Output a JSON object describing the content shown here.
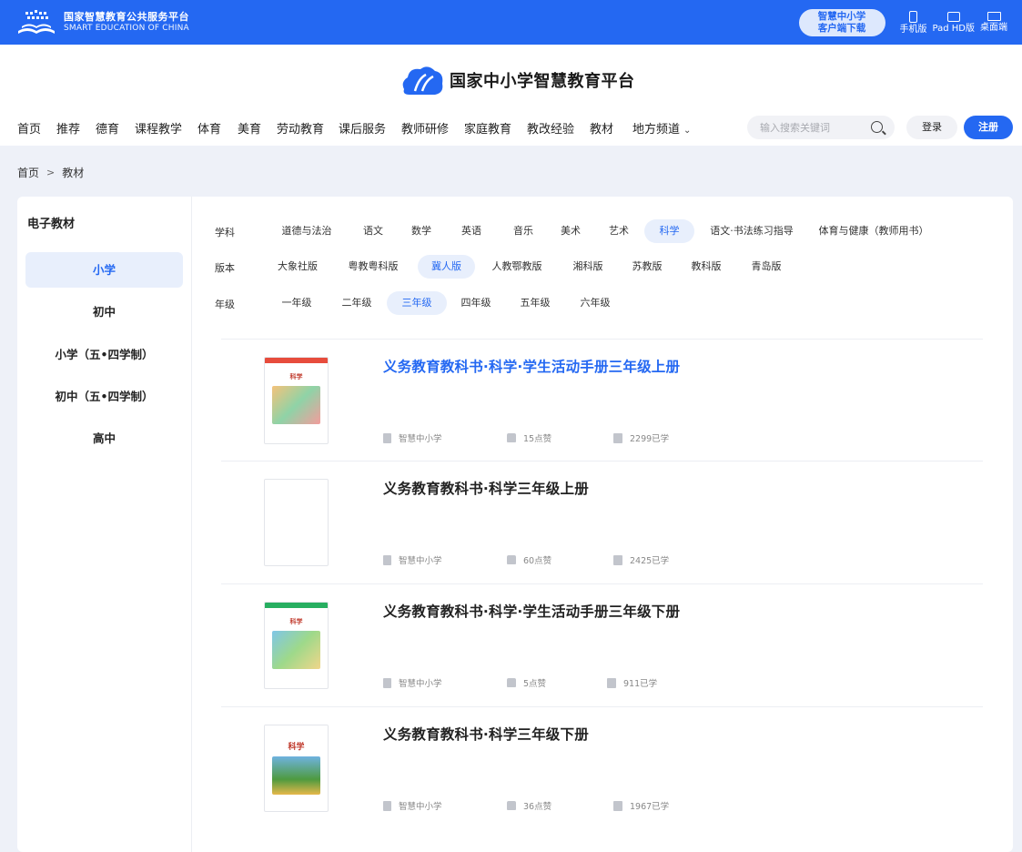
{
  "topbar": {
    "brand_cn": "国家智慧教育公共服务平台",
    "brand_en": "SMART EDUCATION OF CHINA",
    "download_line1": "智慧中小学",
    "download_line2": "客户端下载",
    "devices": [
      {
        "label": "手机版",
        "icon": "phone-icon"
      },
      {
        "label": "Pad HD版",
        "icon": "tablet-icon"
      },
      {
        "label": "桌面端",
        "icon": "desktop-icon"
      }
    ]
  },
  "header": {
    "site_title": "国家中小学智慧教育平台",
    "nav": [
      "首页",
      "推荐",
      "德育",
      "课程教学",
      "体育",
      "美育",
      "劳动教育",
      "课后服务",
      "教师研修",
      "家庭教育",
      "教改经验",
      "教材",
      "地方频道"
    ],
    "search_placeholder": "输入搜索关键词",
    "login": "登录",
    "register": "注册"
  },
  "breadcrumb": [
    "首页",
    "教材"
  ],
  "sidebar": {
    "title": "电子教材",
    "items": [
      {
        "label": "小学",
        "active": true
      },
      {
        "label": "初中",
        "active": false
      },
      {
        "label": "小学（五•四学制）",
        "active": false
      },
      {
        "label": "初中（五•四学制）",
        "active": false
      },
      {
        "label": "高中",
        "active": false
      }
    ]
  },
  "filters": {
    "subject": {
      "label": "学科",
      "options": [
        "道德与法治",
        "语文",
        "数学",
        "英语",
        "音乐",
        "美术",
        "艺术",
        "科学",
        "语文·书法练习指导",
        "体育与健康（教师用书）"
      ],
      "selected": "科学"
    },
    "edition": {
      "label": "版本",
      "options": [
        "大象社版",
        "粤教粤科版",
        "冀人版",
        "人教鄂教版",
        "湘科版",
        "苏教版",
        "教科版",
        "青岛版"
      ],
      "selected": "冀人版"
    },
    "grade": {
      "label": "年级",
      "options": [
        "一年级",
        "二年级",
        "三年级",
        "四年级",
        "五年级",
        "六年级"
      ],
      "selected": "三年级"
    }
  },
  "books": [
    {
      "title": "义务教育教科书·科学·学生活动手册三年级上册",
      "source": "智慧中小学",
      "likes": "15点赞",
      "learners": "2299已学",
      "highlight": true
    },
    {
      "title": "义务教育教科书·科学三年级上册",
      "source": "智慧中小学",
      "likes": "60点赞",
      "learners": "2425已学",
      "highlight": false
    },
    {
      "title": "义务教育教科书·科学·学生活动手册三年级下册",
      "source": "智慧中小学",
      "likes": "5点赞",
      "learners": "911已学",
      "highlight": false
    },
    {
      "title": "义务教育教科书·科学三年级下册",
      "source": "智慧中小学",
      "likes": "36点赞",
      "learners": "1967已学",
      "highlight": false
    }
  ],
  "colors": {
    "primary": "#2468f2",
    "chip_bg": "#e8effc",
    "page_bg": "#eef1f8"
  }
}
